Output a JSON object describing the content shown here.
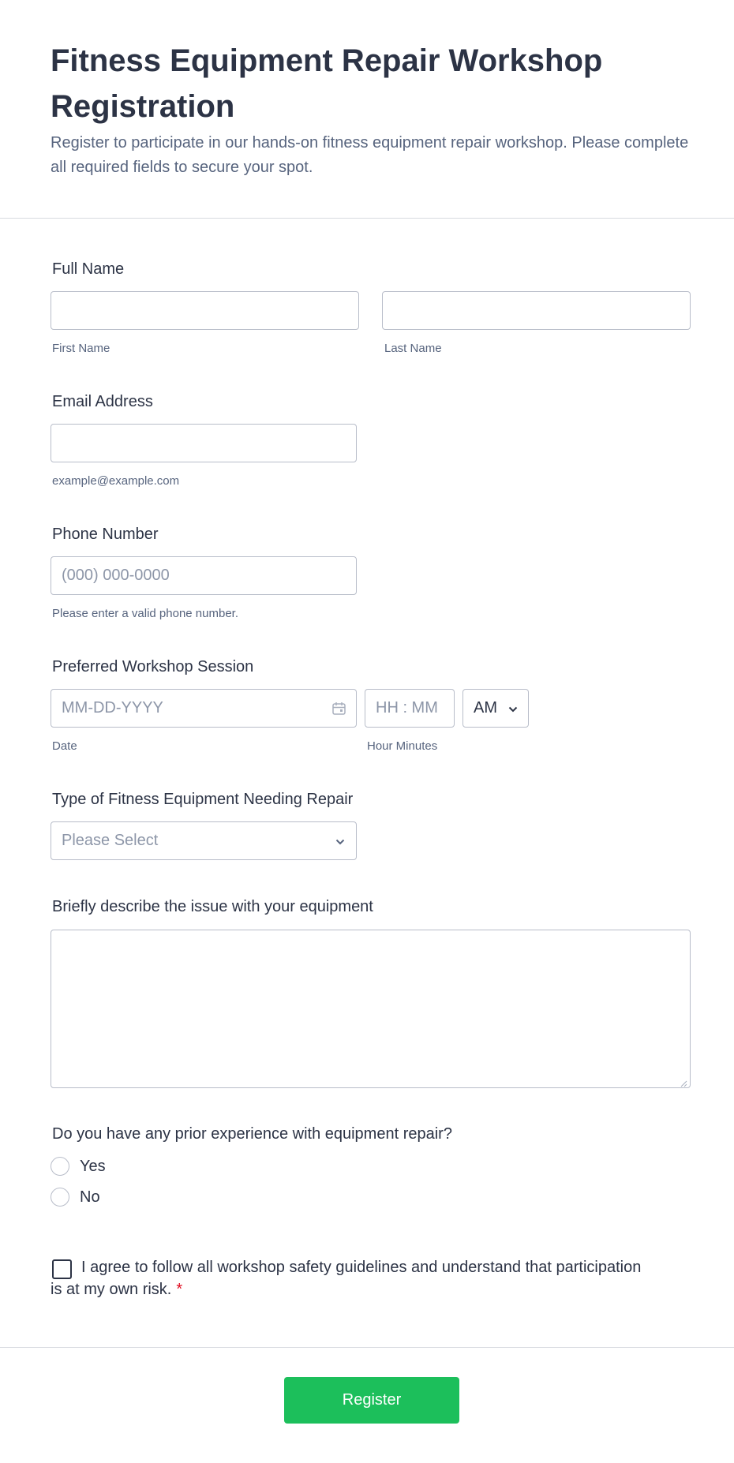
{
  "header": {
    "title": "Fitness Equipment Repair Workshop Registration",
    "subtitle": "Register to participate in our hands-on fitness equipment repair workshop. Please complete all required fields to secure your spot."
  },
  "full_name": {
    "label": "Full Name",
    "first_value": "",
    "last_value": "",
    "first_sublabel": "First Name",
    "last_sublabel": "Last Name"
  },
  "email": {
    "label": "Email Address",
    "value": "",
    "sublabel": "example@example.com"
  },
  "phone": {
    "label": "Phone Number",
    "placeholder": "(000) 000-0000",
    "sublabel": "Please enter a valid phone number."
  },
  "session": {
    "label": "Preferred Workshop Session",
    "date_placeholder": "MM-DD-YYYY",
    "date_sublabel": "Date",
    "time_placeholder": "HH : MM",
    "time_sublabel": "Hour Minutes",
    "ampm_value": "AM",
    "calendar_icon": "calendar-icon"
  },
  "equipment_type": {
    "label": "Type of Fitness Equipment Needing Repair",
    "placeholder": "Please Select"
  },
  "issue": {
    "label": "Briefly describe the issue with your equipment",
    "value": ""
  },
  "experience": {
    "label": "Do you have any prior experience with equipment repair?",
    "options": [
      "Yes",
      "No"
    ]
  },
  "agreement": {
    "text": "I agree to follow all workshop safety guidelines and understand that participation is at my own risk.",
    "required_mark": "*"
  },
  "submit": {
    "label": "Register"
  },
  "colors": {
    "submit_button": "#1cbf5b",
    "required": "#e0091e",
    "text": "#2c3345",
    "muted": "#57647e",
    "border": "#b8bdc9"
  }
}
